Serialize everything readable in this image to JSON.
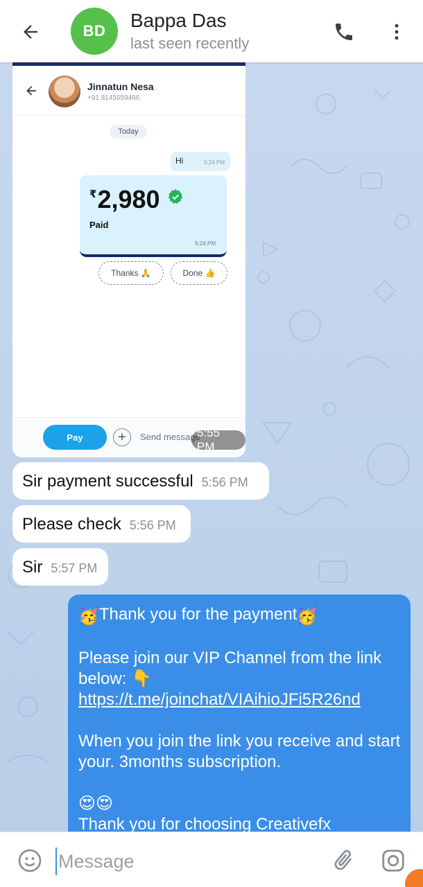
{
  "header": {
    "avatar_initials": "BD",
    "avatar_color": "#55c04a",
    "name": "Bappa Das",
    "status": "last seen recently",
    "icons": [
      "back-arrow-icon",
      "phone-icon",
      "more-vertical-icon"
    ]
  },
  "image_message": {
    "time": "5:55 PM",
    "screenshot": {
      "contact_name": "Jinnatun Nesa",
      "contact_phone": "+91 8145659466",
      "date_chip": "Today",
      "hi_text": "Hi",
      "hi_time": "5:24 PM",
      "currency": "₹",
      "amount": "2,980",
      "status": "Paid",
      "payment_time": "5:24 PM",
      "chip_thanks": "Thanks 🙏",
      "chip_done": "Done 👍",
      "pay_button": "Pay",
      "send_placeholder": "Send message"
    }
  },
  "messages": [
    {
      "text": "Sir payment successful",
      "time": "5:56 PM"
    },
    {
      "text": "Please check",
      "time": "5:56 PM"
    },
    {
      "text": "Sir",
      "time": "5:57 PM"
    }
  ],
  "outgoing": {
    "line1_emoji": "🥳",
    "line1": "Thank you for the payment",
    "line2": "Please join our VIP Channel from the link below: 👇",
    "link": "https://t.me/joinchat/VIAihioJFi5R26nd",
    "line3": "When you join the link you receive and start your. 3months subscription.",
    "emojis": "😍😍",
    "line4": "Thank you for choosing Creativefx"
  },
  "composer": {
    "placeholder": "Message",
    "icons": [
      "emoji-icon",
      "attach-icon",
      "camera-icon"
    ]
  },
  "colors": {
    "accent": "#3a8ee8",
    "outgoing_bubble": "#3a8ee8",
    "chat_background": "#c9d9ec"
  }
}
